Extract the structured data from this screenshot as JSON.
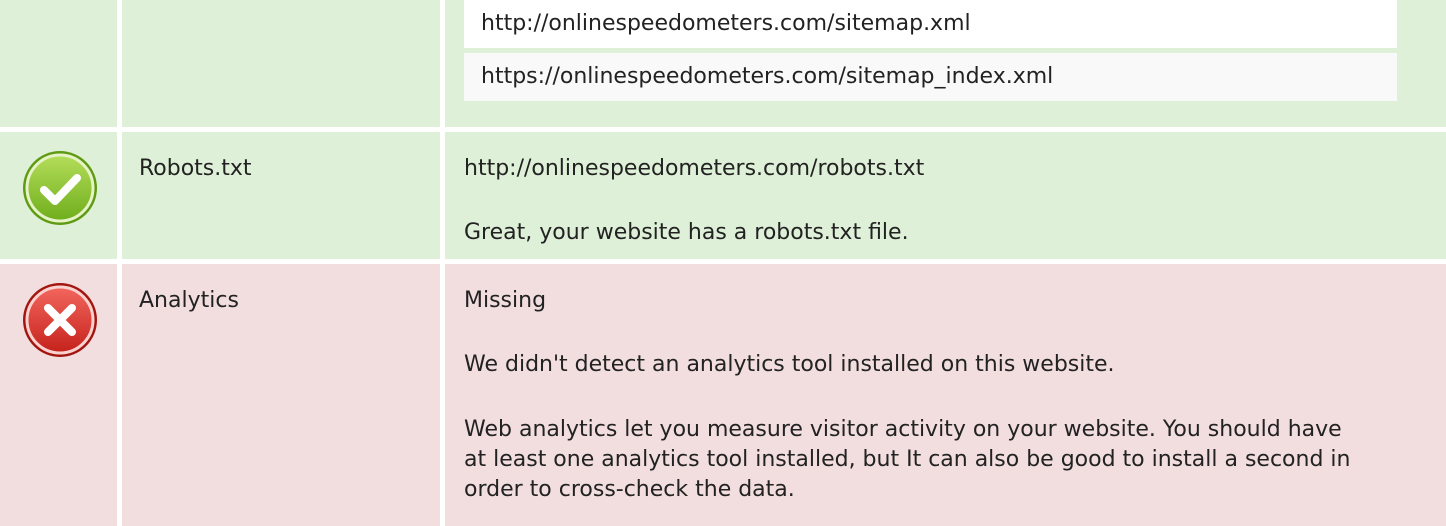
{
  "sitemap": {
    "items": [
      "http://onlinespeedometers.com/sitemap.xml",
      "https://onlinespeedometers.com/sitemap_index.xml"
    ]
  },
  "robots": {
    "name": "Robots.txt",
    "value": "http://onlinespeedometers.com/robots.txt",
    "message": "Great, your website has a robots.txt file.",
    "status_icon": "check-icon",
    "status_color": "#8cc63f"
  },
  "analytics": {
    "name": "Analytics",
    "value": "Missing",
    "message": "We didn't detect an analytics tool installed on this website.",
    "description": "Web analytics let you measure visitor activity on your website. You should have at least one analytics tool installed, but It can also be good to install a second in order to cross-check the data.",
    "status_icon": "error-icon",
    "status_color": "#d9332b"
  },
  "colors": {
    "pass_bg": "#dff0d8",
    "fail_bg": "#f2dede"
  }
}
